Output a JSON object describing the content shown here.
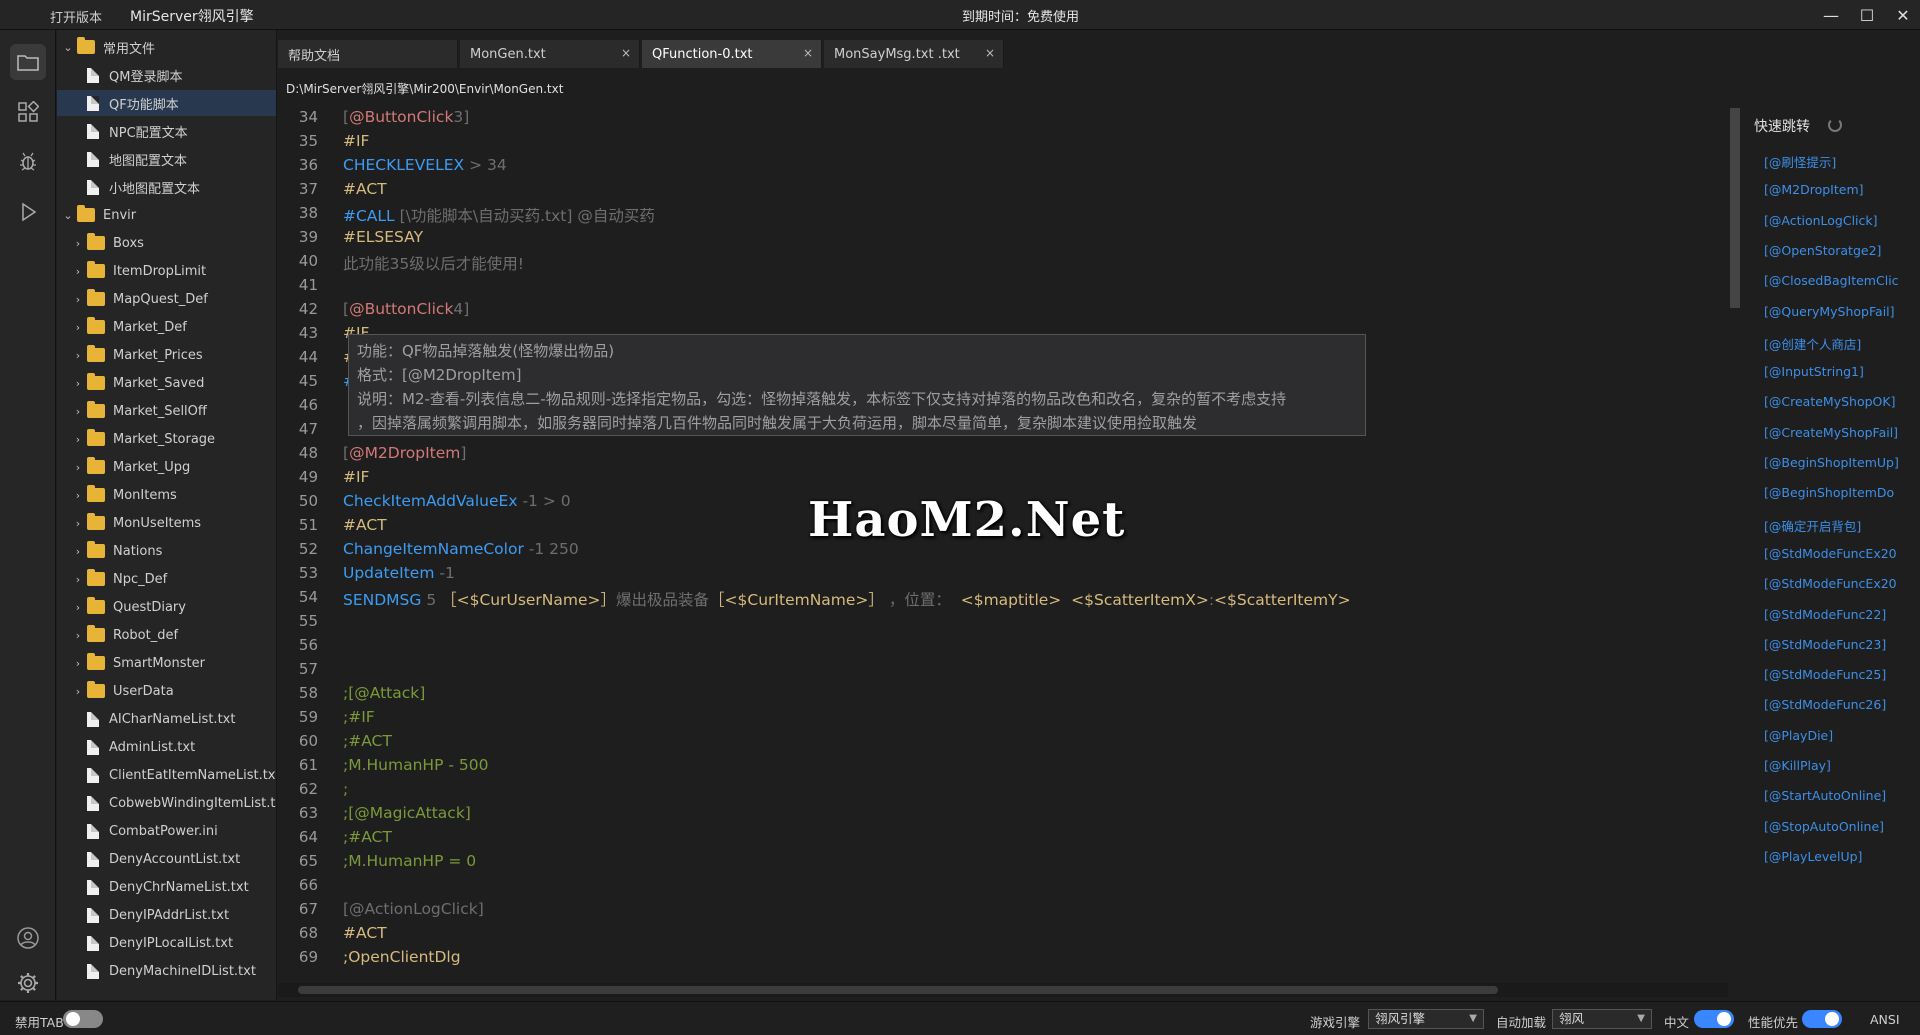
{
  "titlebar": {
    "open_version": "打开版本",
    "app_title": "MirServer翎风引擎",
    "expiry": "到期时间：免费使用",
    "minimize": "—",
    "maximize": "☐",
    "close": "✕"
  },
  "explorer": {
    "items": [
      {
        "label": "常用文件",
        "type": "folder",
        "expanded": true,
        "depth": 0
      },
      {
        "label": "QM登录脚本",
        "type": "file",
        "depth": 1
      },
      {
        "label": "QF功能脚本",
        "type": "file",
        "depth": 1,
        "selected": true
      },
      {
        "label": "NPC配置文本",
        "type": "file",
        "depth": 1
      },
      {
        "label": "地图配置文本",
        "type": "file",
        "depth": 1
      },
      {
        "label": "小地图配置文本",
        "type": "file",
        "depth": 1
      },
      {
        "label": "Envir",
        "type": "folder",
        "expanded": true,
        "depth": 0
      },
      {
        "label": "Boxs",
        "type": "folder",
        "depth": 1
      },
      {
        "label": "ItemDropLimit",
        "type": "folder",
        "depth": 1
      },
      {
        "label": "MapQuest_Def",
        "type": "folder",
        "depth": 1
      },
      {
        "label": "Market_Def",
        "type": "folder",
        "depth": 1
      },
      {
        "label": "Market_Prices",
        "type": "folder",
        "depth": 1
      },
      {
        "label": "Market_Saved",
        "type": "folder",
        "depth": 1
      },
      {
        "label": "Market_SellOff",
        "type": "folder",
        "depth": 1
      },
      {
        "label": "Market_Storage",
        "type": "folder",
        "depth": 1
      },
      {
        "label": "Market_Upg",
        "type": "folder",
        "depth": 1
      },
      {
        "label": "MonItems",
        "type": "folder",
        "depth": 1
      },
      {
        "label": "MonUseItems",
        "type": "folder",
        "depth": 1
      },
      {
        "label": "Nations",
        "type": "folder",
        "depth": 1
      },
      {
        "label": "Npc_Def",
        "type": "folder",
        "depth": 1
      },
      {
        "label": "QuestDiary",
        "type": "folder",
        "depth": 1
      },
      {
        "label": "Robot_def",
        "type": "folder",
        "depth": 1
      },
      {
        "label": "SmartMonster",
        "type": "folder",
        "depth": 1
      },
      {
        "label": "UserData",
        "type": "folder",
        "depth": 1
      },
      {
        "label": "AICharNameList.txt",
        "type": "file",
        "depth": 1
      },
      {
        "label": "AdminList.txt",
        "type": "file",
        "depth": 1
      },
      {
        "label": "ClientEatItemNameList.txt",
        "type": "file",
        "depth": 1
      },
      {
        "label": "CobwebWindingItemList.t",
        "type": "file",
        "depth": 1
      },
      {
        "label": "CombatPower.ini",
        "type": "file",
        "depth": 1
      },
      {
        "label": "DenyAccountList.txt",
        "type": "file",
        "depth": 1
      },
      {
        "label": "DenyChrNameList.txt",
        "type": "file",
        "depth": 1
      },
      {
        "label": "DenyIPAddrList.txt",
        "type": "file",
        "depth": 1
      },
      {
        "label": "DenyIPLocalList.txt",
        "type": "file",
        "depth": 1
      },
      {
        "label": "DenyMachineIDList.txt",
        "type": "file",
        "depth": 1
      }
    ]
  },
  "tabs": [
    {
      "label": "帮助文档",
      "closable": false,
      "active": false
    },
    {
      "label": "MonGen.txt",
      "closable": true,
      "active": false
    },
    {
      "label": "QFunction-0.txt",
      "closable": true,
      "active": true
    },
    {
      "label": "MonSayMsg.txt .txt",
      "closable": true,
      "active": false
    }
  ],
  "path": "D:\\MirServer翎风引擎\\Mir200\\Envir\\MonGen.txt",
  "code_lines": [
    {
      "n": "34",
      "parts": [
        [
          "c-gray",
          "["
        ],
        [
          "c-red",
          "@ButtonClick"
        ],
        [
          "c-gray",
          "3]"
        ]
      ]
    },
    {
      "n": "35",
      "parts": [
        [
          "c-orange",
          "#IF"
        ]
      ]
    },
    {
      "n": "36",
      "parts": [
        [
          "c-blue",
          "CHECKLEVELEX"
        ],
        [
          "c-gray",
          " > 34"
        ]
      ]
    },
    {
      "n": "37",
      "parts": [
        [
          "c-orange",
          "#ACT"
        ]
      ]
    },
    {
      "n": "38",
      "parts": [
        [
          "c-blue",
          "#CALL"
        ],
        [
          "c-gray",
          " [\\功能脚本\\自动买药.txt] @自动买药"
        ]
      ]
    },
    {
      "n": "39",
      "parts": [
        [
          "c-orange",
          "#ELSESAY"
        ]
      ]
    },
    {
      "n": "40",
      "parts": [
        [
          "c-gray",
          "此功能35级以后才能使用!"
        ]
      ]
    },
    {
      "n": "41",
      "parts": []
    },
    {
      "n": "42",
      "parts": [
        [
          "c-gray",
          "["
        ],
        [
          "c-red",
          "@ButtonClick"
        ],
        [
          "c-gray",
          "4]"
        ]
      ]
    },
    {
      "n": "43",
      "parts": [
        [
          "c-orange",
          "#IF"
        ]
      ]
    },
    {
      "n": "44",
      "parts": [
        [
          "c-orange",
          "#"
        ]
      ]
    },
    {
      "n": "45",
      "parts": [
        [
          "c-blue",
          "#"
        ]
      ]
    },
    {
      "n": "46",
      "parts": []
    },
    {
      "n": "47",
      "parts": []
    },
    {
      "n": "48",
      "parts": [
        [
          "c-gray",
          "["
        ],
        [
          "c-red",
          "@M2DropItem"
        ],
        [
          "c-gray",
          "]"
        ]
      ]
    },
    {
      "n": "49",
      "parts": [
        [
          "c-orange",
          "#IF"
        ]
      ]
    },
    {
      "n": "50",
      "parts": [
        [
          "c-blue",
          "CheckItemAddValueEx"
        ],
        [
          "c-gray",
          " -1 > 0"
        ]
      ]
    },
    {
      "n": "51",
      "parts": [
        [
          "c-orange",
          "#ACT"
        ]
      ]
    },
    {
      "n": "52",
      "parts": [
        [
          "c-blue",
          "ChangeItemNameColor"
        ],
        [
          "c-gray",
          " -1 250"
        ]
      ]
    },
    {
      "n": "53",
      "parts": [
        [
          "c-blue",
          "UpdateItem"
        ],
        [
          "c-gray",
          " -1"
        ]
      ]
    },
    {
      "n": "54",
      "parts": [
        [
          "c-blue",
          "SENDMSG"
        ],
        [
          "c-gray",
          " 5 "
        ],
        [
          "c-orange",
          "［<$CurUserName>］"
        ],
        [
          "c-gray",
          "爆出极品装备"
        ],
        [
          "c-orange",
          "［<$CurItemName>］"
        ],
        [
          "c-gray",
          " ，位置：  "
        ],
        [
          "c-orange",
          "<$maptitle>  <$ScatterItemX>"
        ],
        [
          "c-gray",
          ":"
        ],
        [
          "c-orange",
          "<$ScatterItemY>"
        ]
      ]
    },
    {
      "n": "55",
      "parts": []
    },
    {
      "n": "56",
      "parts": []
    },
    {
      "n": "57",
      "parts": []
    },
    {
      "n": "58",
      "parts": [
        [
          "c-green",
          ";[@Attack]"
        ]
      ]
    },
    {
      "n": "59",
      "parts": [
        [
          "c-green",
          ";#IF"
        ]
      ]
    },
    {
      "n": "60",
      "parts": [
        [
          "c-green",
          ";#ACT"
        ]
      ]
    },
    {
      "n": "61",
      "parts": [
        [
          "c-green",
          ";M.HumanHP - 500"
        ]
      ]
    },
    {
      "n": "62",
      "parts": [
        [
          "c-green",
          ";"
        ]
      ]
    },
    {
      "n": "63",
      "parts": [
        [
          "c-green",
          ";[@MagicAttack]"
        ]
      ]
    },
    {
      "n": "64",
      "parts": [
        [
          "c-green",
          ";#ACT"
        ]
      ]
    },
    {
      "n": "65",
      "parts": [
        [
          "c-green",
          ";M.HumanHP = 0"
        ]
      ]
    },
    {
      "n": "66",
      "parts": []
    },
    {
      "n": "67",
      "parts": [
        [
          "c-gray",
          "[@ActionLogClick]"
        ]
      ]
    },
    {
      "n": "68",
      "parts": [
        [
          "c-orange",
          "#ACT"
        ]
      ]
    },
    {
      "n": "69",
      "parts": [
        [
          "c-orange",
          ";OpenClientDlg"
        ]
      ]
    }
  ],
  "tooltip": {
    "line1": "功能：QF物品掉落触发(怪物爆出物品)",
    "line2": "格式：[@M2DropItem]",
    "line3": "说明：M2-查看-列表信息二-物品规则-选择指定物品，勾选：怪物掉落触发，本标签下仅支持对掉落的物品改色和改名，复杂的暂不考虑支持",
    "line4": "，因掉落属频繁调用脚本，如服务器同时掉落几百件物品同时触发属于大负荷运用，脚本尽量简单，复杂脚本建议使用捡取触发"
  },
  "watermark": "HaoM2.Net",
  "quickjump": {
    "title": "快速跳转",
    "items": [
      "[@刷怪提示]",
      "[@M2DropItem]",
      "[@ActionLogClick]",
      "[@OpenStoratge2]",
      "[@ClosedBagItemClic",
      "[@QueryMyShopFail]",
      "[@创建个人商店]",
      "[@InputString1]",
      "[@CreateMyShopOK]",
      "[@CreateMyShopFail]",
      "[@BeginShopItemUp]",
      "[@BeginShopItemDo",
      "[@确定开启背包]",
      "[@StdModeFuncEx20",
      "[@StdModeFuncEx20",
      "[@StdModeFunc22]",
      "[@StdModeFunc23]",
      "[@StdModeFunc25]",
      "[@StdModeFunc26]",
      "[@PlayDie]",
      "[@KillPlay]",
      "[@StartAutoOnline]",
      "[@StopAutoOnline]",
      "[@PlayLevelUp]"
    ]
  },
  "statusbar": {
    "disable_tab_label": "禁用TAB",
    "disable_tab_on": false,
    "game_engine_label": "游戏引擎",
    "game_engine_value": "翎风引擎",
    "auto_load_label": "自动加载",
    "auto_load_value": "翎风",
    "chinese_label": "中文",
    "chinese_on": true,
    "perf_label": "性能优先",
    "perf_on": true,
    "encoding": "ANSI"
  },
  "colors": {
    "accent": "#3a86ff",
    "keyword": "#3d9cf2",
    "label": "#d27878",
    "directive": "#d7ba7d",
    "comment": "#7a9a3a"
  }
}
